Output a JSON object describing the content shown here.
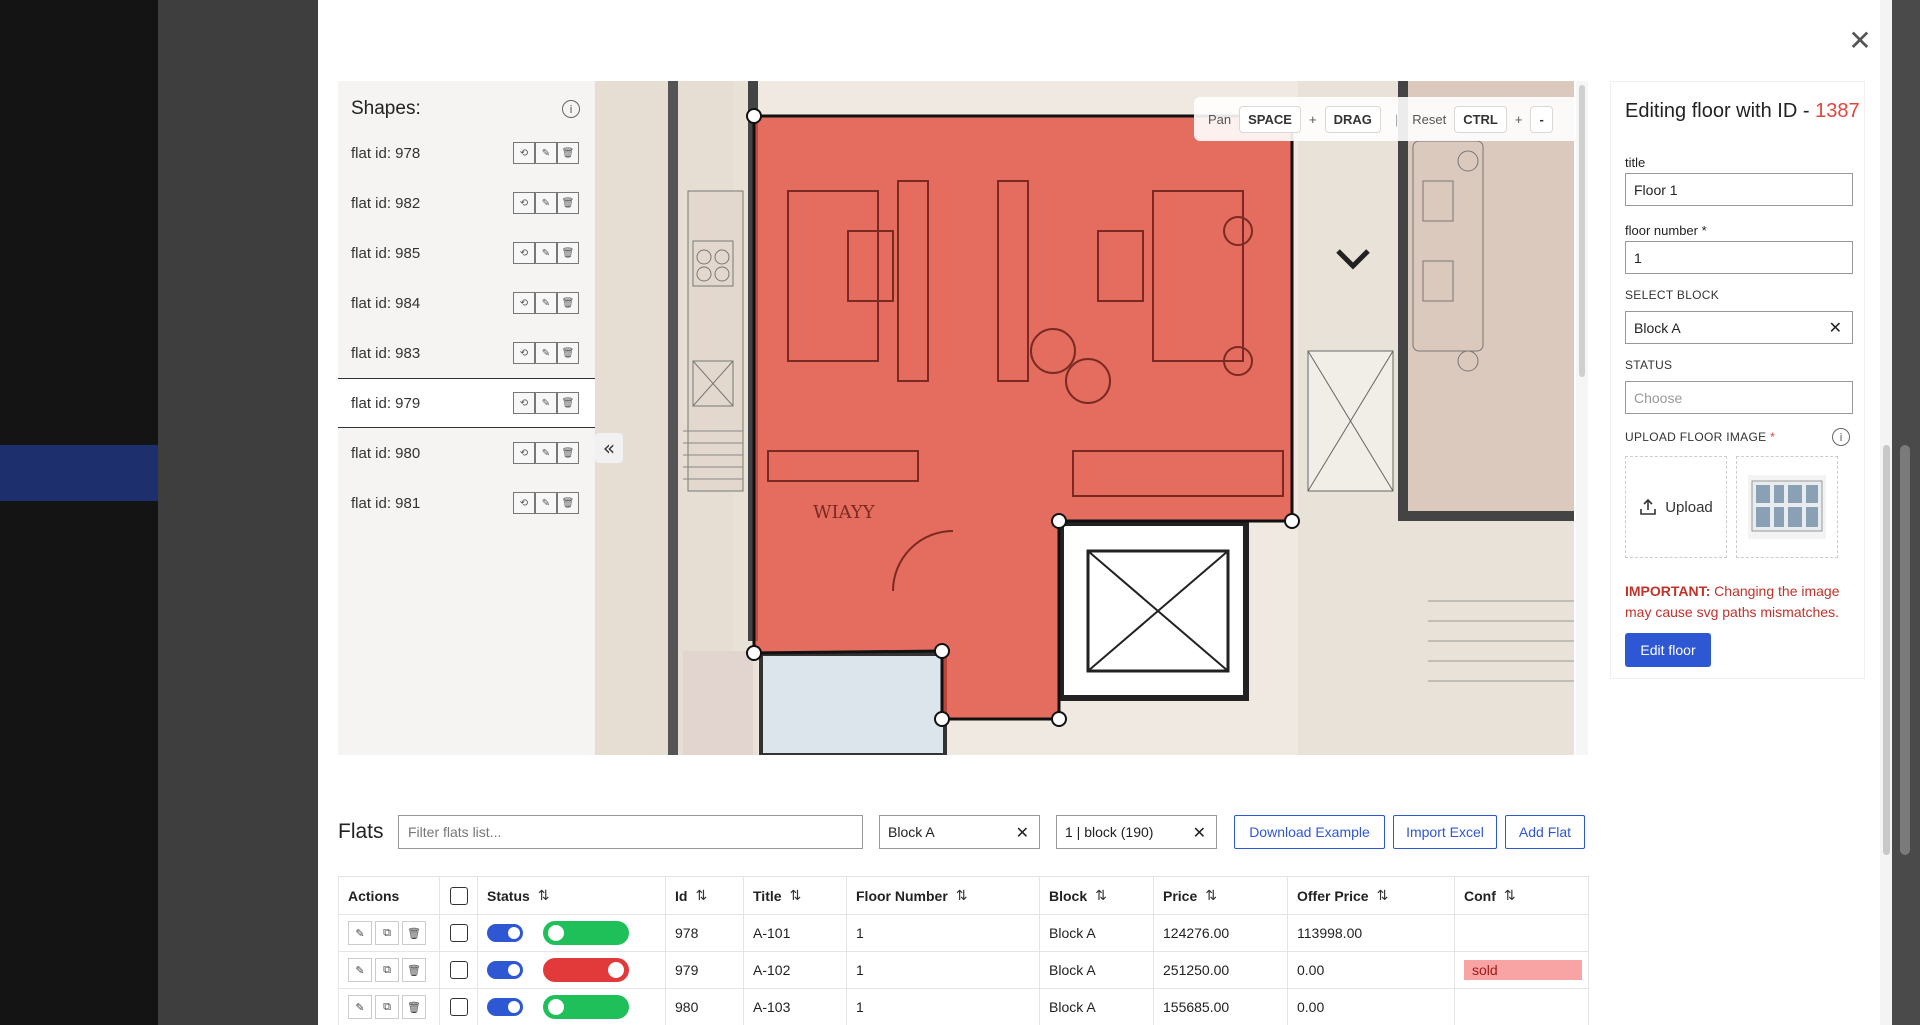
{
  "shapes": {
    "title": "Shapes:",
    "items": [
      {
        "label": "flat id: 978"
      },
      {
        "label": "flat id: 982"
      },
      {
        "label": "flat id: 985"
      },
      {
        "label": "flat id: 984"
      },
      {
        "label": "flat id: 983"
      },
      {
        "label": "flat id: 979"
      },
      {
        "label": "flat id: 980"
      },
      {
        "label": "flat id: 981"
      }
    ],
    "selected": "flat id: 979"
  },
  "hints": {
    "pan_label": "Pan",
    "space_key": "SPACE",
    "plus": "+",
    "drag_key": "DRAG",
    "sep": "|",
    "reset_label": "Reset",
    "ctrl_key": "CTRL",
    "minus": "-"
  },
  "form": {
    "title_prefix": "Editing floor with ID - ",
    "floor_id": "1387",
    "title_label": "title",
    "title_value": "Floor 1",
    "floor_number_label": "floor number",
    "floor_number_value": "1",
    "block_label": "SELECT BLOCK",
    "block_value": "Block A",
    "status_label": "STATUS",
    "status_placeholder": "Choose",
    "upload_label": "UPLOAD FLOOR IMAGE",
    "upload_button": "Upload",
    "important_prefix": "IMPORTANT:",
    "important_text": " Changing the image may cause svg paths mismatches.",
    "submit": "Edit floor",
    "required_mark": "*"
  },
  "flats": {
    "title": "Flats",
    "search_placeholder": "Filter flats list...",
    "block_filter": "Block A",
    "floor_filter": "1  | block (190)",
    "download_example": "Download Example",
    "import_excel": "Import Excel",
    "add_flat": "Add Flat",
    "columns": [
      "Actions",
      "Status",
      "Id",
      "Title",
      "Floor Number",
      "Block",
      "Price",
      "Offer Price",
      "Conf"
    ],
    "rows": [
      {
        "id": "978",
        "title": "A-101",
        "floor": "1",
        "block": "Block A",
        "price": "124276.00",
        "offer": "113998.00",
        "status": "green",
        "conf": ""
      },
      {
        "id": "979",
        "title": "A-102",
        "floor": "1",
        "block": "Block A",
        "price": "251250.00",
        "offer": "0.00",
        "status": "red",
        "conf": "sold"
      },
      {
        "id": "980",
        "title": "A-103",
        "floor": "1",
        "block": "Block A",
        "price": "155685.00",
        "offer": "0.00",
        "status": "green",
        "conf": ""
      }
    ]
  },
  "icons": {
    "close": "close-icon",
    "info": "info-icon",
    "collapse": "double-chevron-left-icon",
    "upload": "upload-icon",
    "sort": "sort-icon",
    "edit": "edit-icon",
    "copy": "copy-icon",
    "delete": "trash-icon",
    "refresh": "refresh-icon"
  },
  "colors": {
    "accent": "#2e57d4",
    "id_red": "#e0463c",
    "shape_fill": "#e04a3a",
    "status_on": "#1fbf5a",
    "status_off": "#e23a3a",
    "sold_badge": "#f8a4a4"
  }
}
